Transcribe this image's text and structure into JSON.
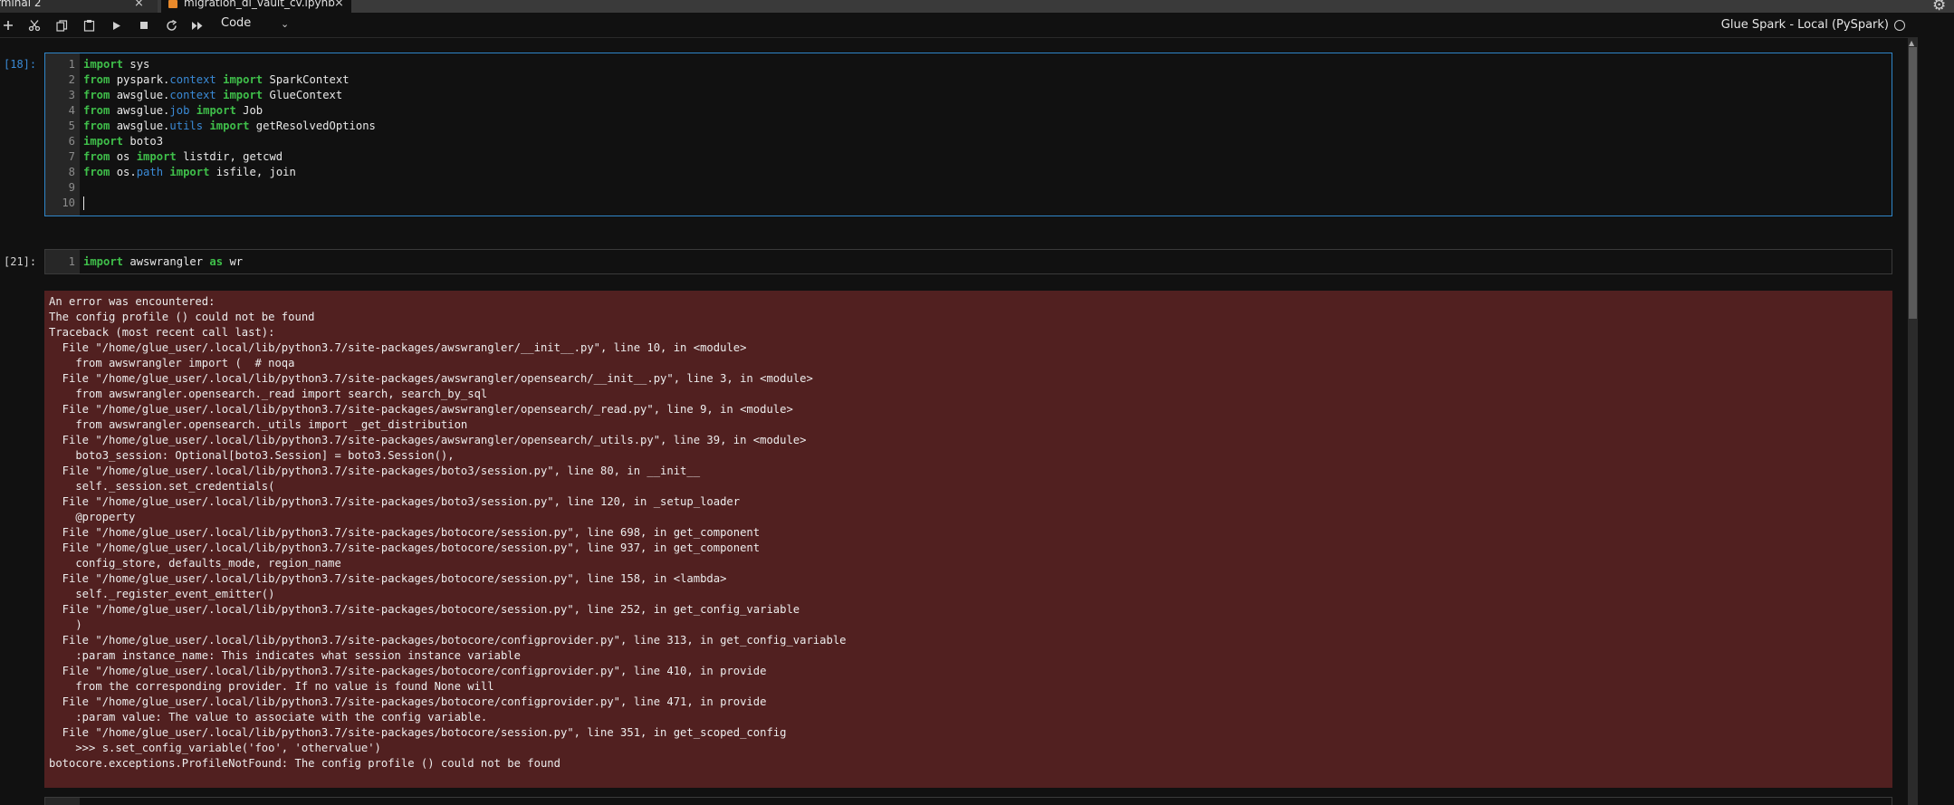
{
  "tabs": [
    {
      "label": "rminal 2",
      "close": "×"
    },
    {
      "label": "migration_dl_vault_cv.ipynb",
      "close": "×"
    }
  ],
  "toolbar": {
    "icons": [
      "add-icon",
      "cut-icon",
      "copy-icon",
      "paste-icon",
      "run-icon",
      "stop-icon",
      "restart-icon",
      "fast-forward-icon"
    ],
    "cell_type": "Code",
    "kernel_name": "Glue Spark - Local (PySpark)"
  },
  "cells": [
    {
      "prompt": "[18]:",
      "lines": [
        {
          "n": "1",
          "tokens": [
            [
              "kw",
              "import"
            ],
            [
              "t",
              " sys"
            ]
          ]
        },
        {
          "n": "2",
          "tokens": [
            [
              "kw",
              "from"
            ],
            [
              "t",
              " pyspark."
            ],
            [
              "mod",
              "context"
            ],
            [
              "t",
              " "
            ],
            [
              "kw",
              "import"
            ],
            [
              "t",
              " SparkContext"
            ]
          ]
        },
        {
          "n": "3",
          "tokens": [
            [
              "kw",
              "from"
            ],
            [
              "t",
              " awsglue."
            ],
            [
              "mod",
              "context"
            ],
            [
              "t",
              " "
            ],
            [
              "kw",
              "import"
            ],
            [
              "t",
              " GlueContext"
            ]
          ]
        },
        {
          "n": "4",
          "tokens": [
            [
              "kw",
              "from"
            ],
            [
              "t",
              " awsglue."
            ],
            [
              "mod",
              "job"
            ],
            [
              "t",
              " "
            ],
            [
              "kw",
              "import"
            ],
            [
              "t",
              " Job"
            ]
          ]
        },
        {
          "n": "5",
          "tokens": [
            [
              "kw",
              "from"
            ],
            [
              "t",
              " awsglue."
            ],
            [
              "mod",
              "utils"
            ],
            [
              "t",
              " "
            ],
            [
              "kw",
              "import"
            ],
            [
              "t",
              " getResolvedOptions"
            ]
          ]
        },
        {
          "n": "6",
          "tokens": [
            [
              "kw",
              "import"
            ],
            [
              "t",
              " boto3"
            ]
          ]
        },
        {
          "n": "7",
          "tokens": [
            [
              "kw",
              "from"
            ],
            [
              "t",
              " os "
            ],
            [
              "kw",
              "import"
            ],
            [
              "t",
              " listdir, getcwd"
            ]
          ]
        },
        {
          "n": "8",
          "tokens": [
            [
              "kw",
              "from"
            ],
            [
              "t",
              " os."
            ],
            [
              "mod",
              "path"
            ],
            [
              "t",
              " "
            ],
            [
              "kw",
              "import"
            ],
            [
              "t",
              " isfile, join"
            ]
          ]
        },
        {
          "n": "9",
          "tokens": []
        },
        {
          "n": "10",
          "tokens": [
            [
              "cursor",
              ""
            ]
          ]
        }
      ]
    },
    {
      "prompt": "[21]:",
      "lines": [
        {
          "n": "1",
          "tokens": [
            [
              "kw",
              "import"
            ],
            [
              "t",
              " awswrangler "
            ],
            [
              "kw",
              "as"
            ],
            [
              "t",
              " wr"
            ]
          ]
        }
      ]
    }
  ],
  "error_output": [
    "An error was encountered:",
    "The config profile () could not be found",
    "Traceback (most recent call last):",
    "  File \"/home/glue_user/.local/lib/python3.7/site-packages/awswrangler/__init__.py\", line 10, in <module>",
    "    from awswrangler import (  # noqa",
    "  File \"/home/glue_user/.local/lib/python3.7/site-packages/awswrangler/opensearch/__init__.py\", line 3, in <module>",
    "    from awswrangler.opensearch._read import search, search_by_sql",
    "  File \"/home/glue_user/.local/lib/python3.7/site-packages/awswrangler/opensearch/_read.py\", line 9, in <module>",
    "    from awswrangler.opensearch._utils import _get_distribution",
    "  File \"/home/glue_user/.local/lib/python3.7/site-packages/awswrangler/opensearch/_utils.py\", line 39, in <module>",
    "    boto3_session: Optional[boto3.Session] = boto3.Session(),",
    "  File \"/home/glue_user/.local/lib/python3.7/site-packages/boto3/session.py\", line 80, in __init__",
    "    self._session.set_credentials(",
    "  File \"/home/glue_user/.local/lib/python3.7/site-packages/boto3/session.py\", line 120, in _setup_loader",
    "    @property",
    "  File \"/home/glue_user/.local/lib/python3.7/site-packages/botocore/session.py\", line 698, in get_component",
    "  File \"/home/glue_user/.local/lib/python3.7/site-packages/botocore/session.py\", line 937, in get_component",
    "    config_store, defaults_mode, region_name",
    "  File \"/home/glue_user/.local/lib/python3.7/site-packages/botocore/session.py\", line 158, in <lambda>",
    "    self._register_event_emitter()",
    "  File \"/home/glue_user/.local/lib/python3.7/site-packages/botocore/session.py\", line 252, in get_config_variable",
    "    )",
    "  File \"/home/glue_user/.local/lib/python3.7/site-packages/botocore/configprovider.py\", line 313, in get_config_variable",
    "    :param instance_name: This indicates what session instance variable",
    "  File \"/home/glue_user/.local/lib/python3.7/site-packages/botocore/configprovider.py\", line 410, in provide",
    "    from the corresponding provider. If no value is found None will",
    "  File \"/home/glue_user/.local/lib/python3.7/site-packages/botocore/configprovider.py\", line 471, in provide",
    "    :param value: The value to associate with the config variable.",
    "  File \"/home/glue_user/.local/lib/python3.7/site-packages/botocore/session.py\", line 351, in get_scoped_config",
    "    >>> s.set_config_variable('foo', 'othervalue')",
    "botocore.exceptions.ProfileNotFound: The config profile () could not be found"
  ],
  "colors": {
    "keyword": "#3fbf4a",
    "module": "#3a8ad6",
    "active_prompt": "#3a8ad6",
    "active_cell_border": "#2f86c9",
    "error_background": "#512020",
    "notebook_icon": "#e8892b"
  }
}
